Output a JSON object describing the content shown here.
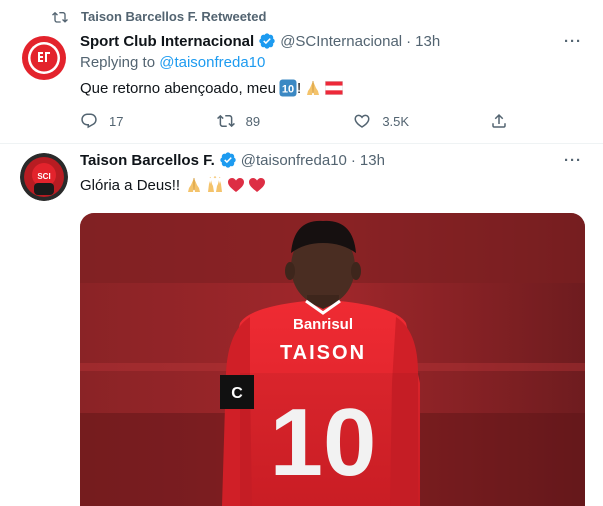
{
  "retweet": {
    "label": "Taison Barcellos F. Retweeted"
  },
  "tweets": [
    {
      "name": "Sport Club Internacional",
      "handle": "@SCInternacional",
      "separator": "·",
      "time": "13h",
      "replying_prefix": "Replying to",
      "replying_handle": "@taisonfreda10",
      "text": "Que retorno abençoado, meu",
      "text_suffix": "!",
      "emojis": [
        "keycap-ten-emoji",
        "folded-hands-emoji",
        "austria-flag-emoji"
      ],
      "actions": {
        "replies": "17",
        "retweets": "89",
        "likes": "3.5K"
      }
    },
    {
      "name": "Taison Barcellos F.",
      "handle": "@taisonfreda10",
      "separator": "·",
      "time": "13h",
      "text": "Glória a Deus!!",
      "emojis": [
        "folded-hands-emoji",
        "raising-hands-emoji",
        "red-heart-emoji",
        "red-heart-emoji"
      ],
      "photo": {
        "sponsor": "Banrisul",
        "player_name": "TAISON",
        "number": "10",
        "armband": "C"
      }
    }
  ],
  "colors": {
    "accent": "#1d9bf0",
    "secondary_text": "#536471",
    "jersey_red": "#e3232c"
  }
}
